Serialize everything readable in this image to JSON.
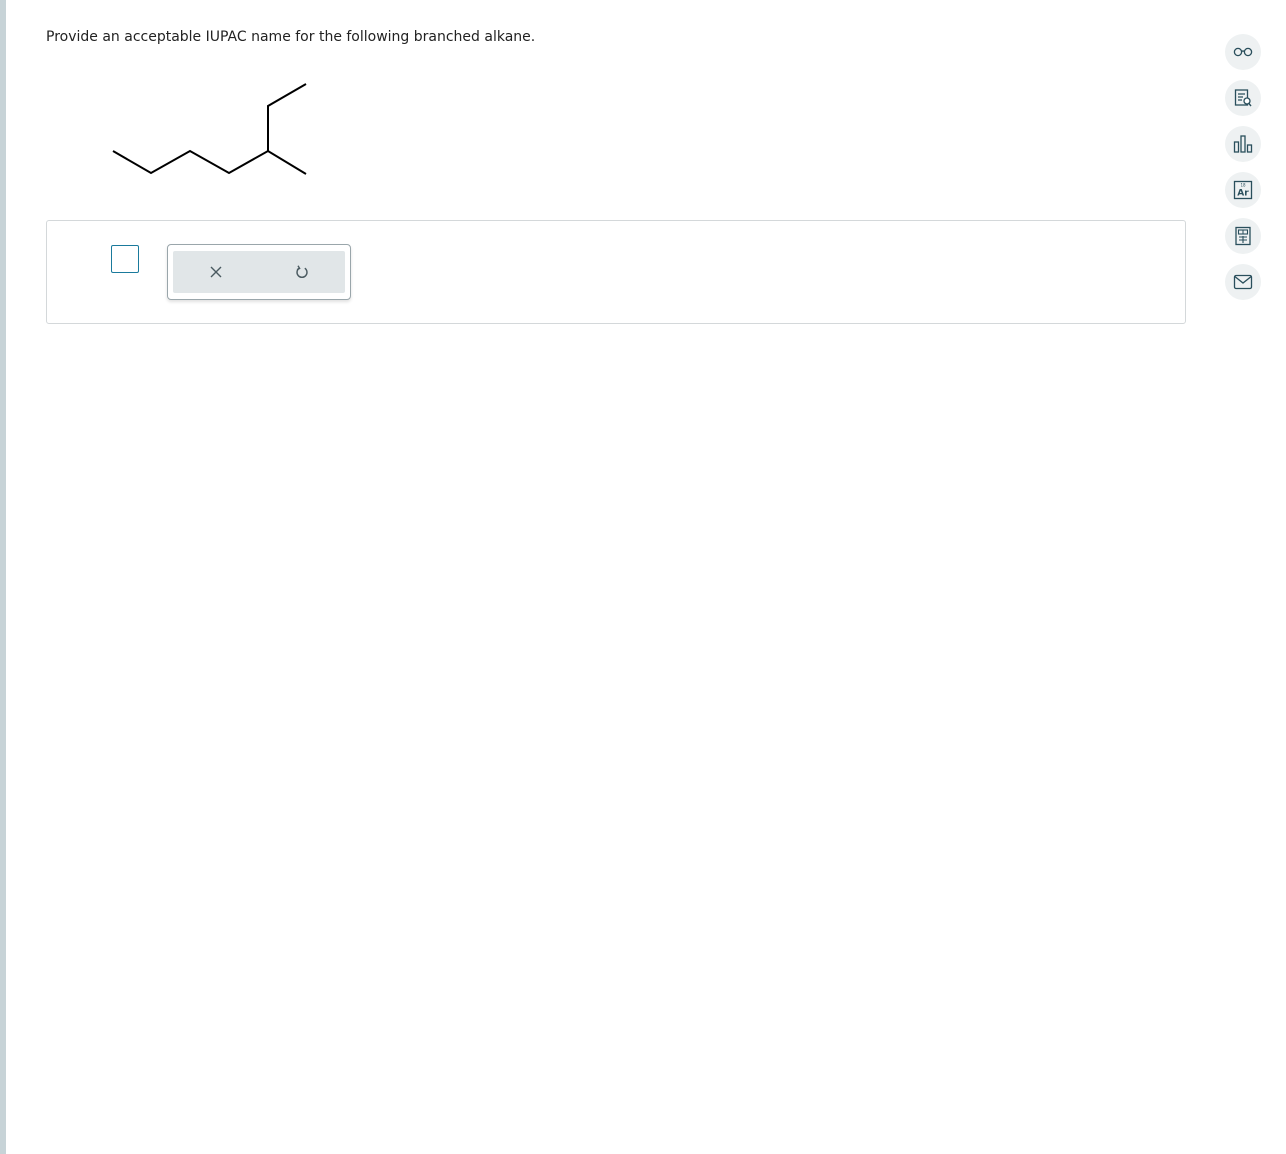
{
  "question": {
    "text": "Provide an acceptable IUPAC name for the following branched alkane."
  },
  "answer": {
    "value": ""
  },
  "toolbox": {
    "clear_icon": "close-icon",
    "undo_icon": "undo-icon"
  },
  "sidebar": {
    "items": [
      {
        "icon": "glasses-icon"
      },
      {
        "icon": "document-search-icon"
      },
      {
        "icon": "bar-chart-icon"
      },
      {
        "icon": "periodic-element-icon",
        "label": "Ar",
        "number": "18"
      },
      {
        "icon": "calculator-icon"
      },
      {
        "icon": "mail-icon"
      }
    ]
  },
  "colors": {
    "accent": "#1a7a9c",
    "icon": "#2a4f5c",
    "toolbar_bg": "#e1e6e8",
    "strip": "#c7d3d7"
  }
}
